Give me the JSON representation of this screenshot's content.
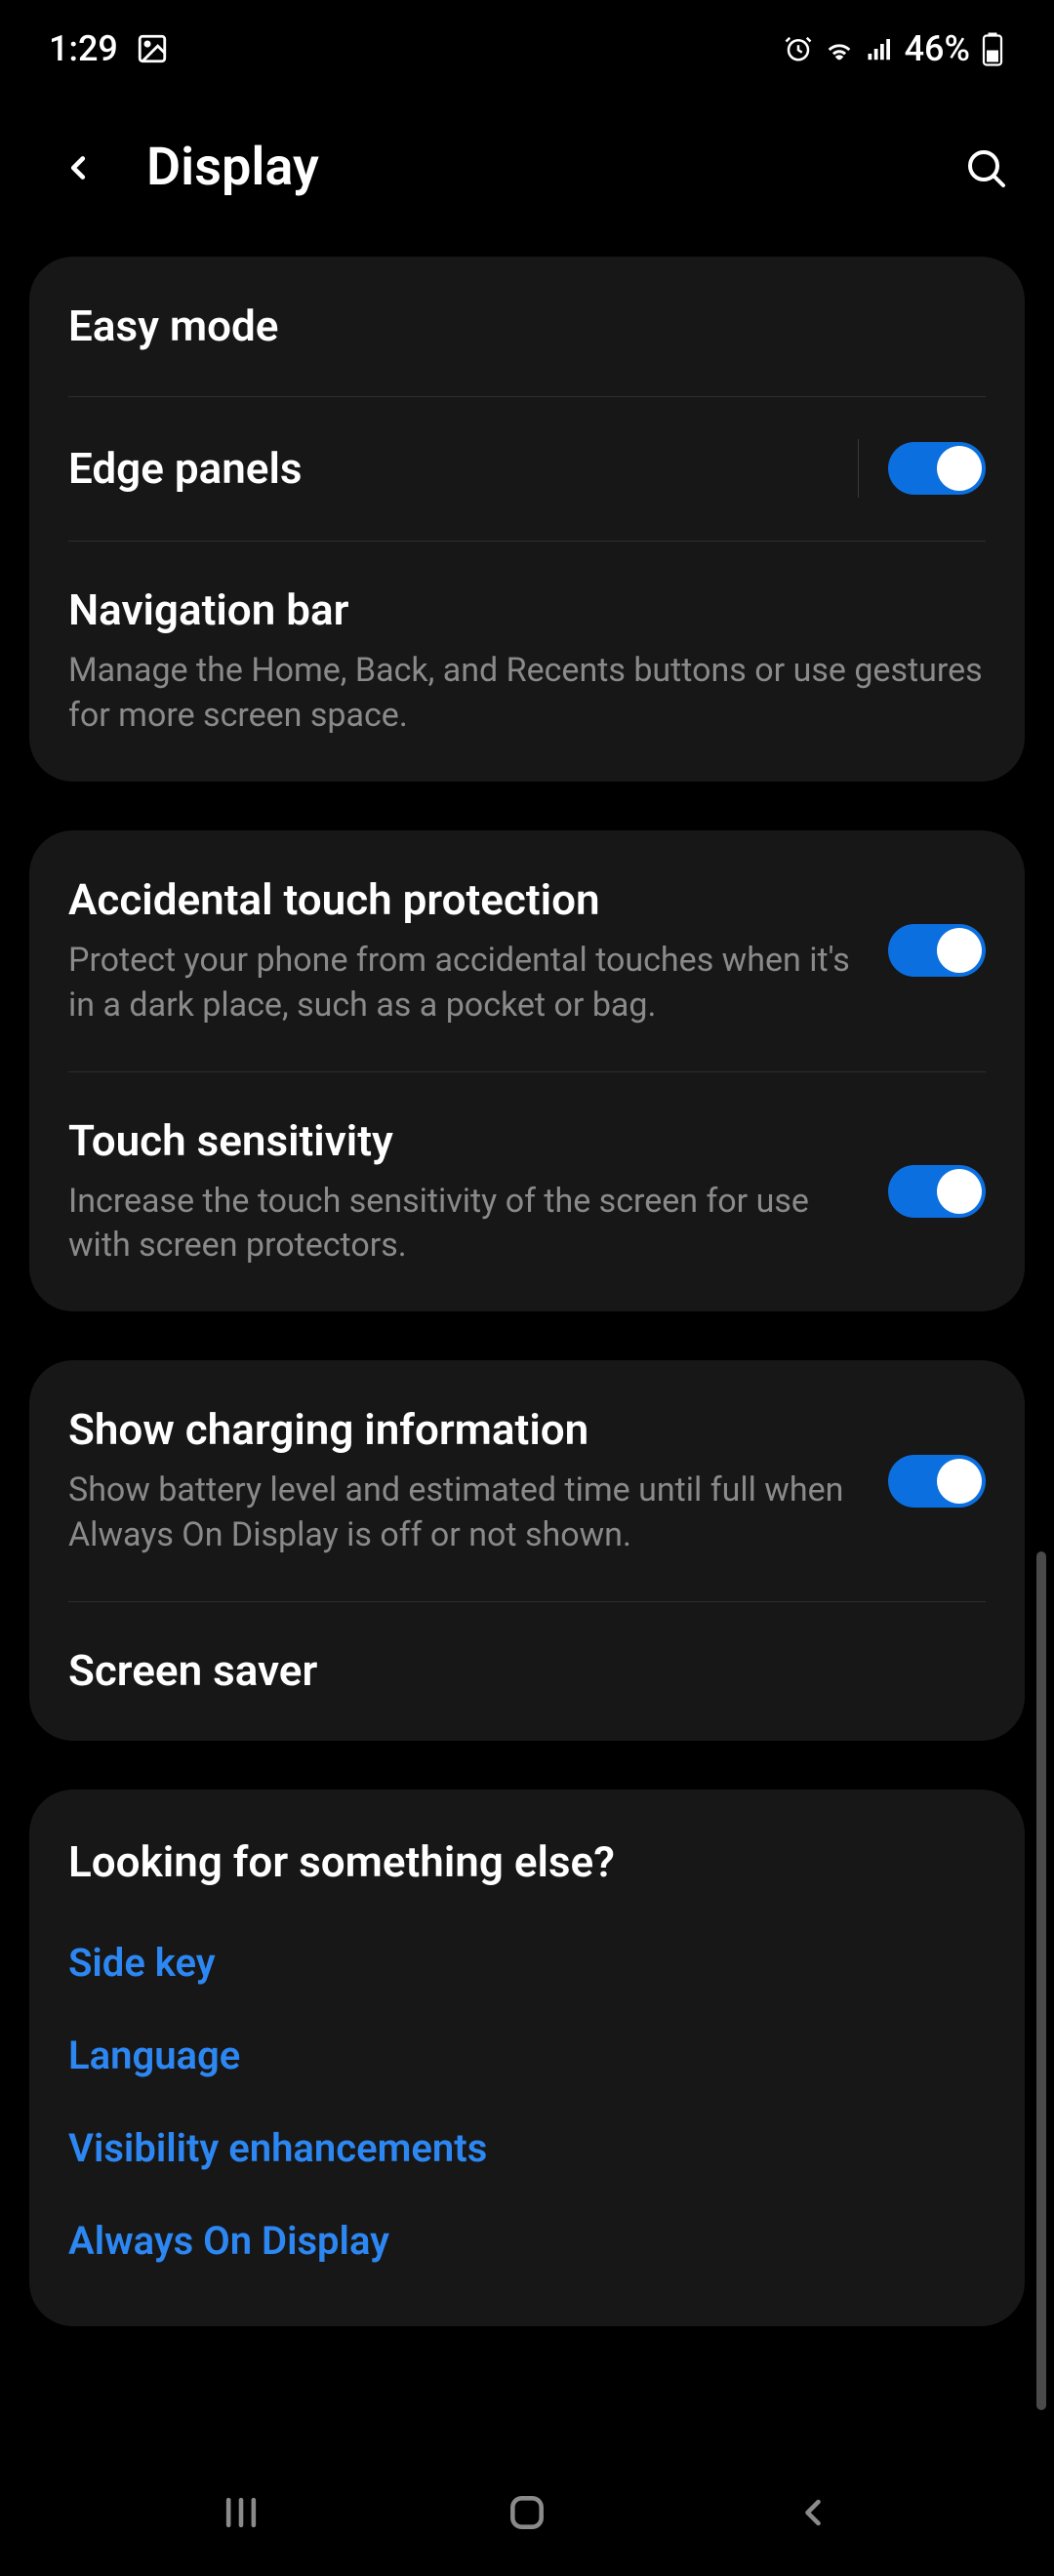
{
  "status": {
    "time": "1:29",
    "battery": "46%"
  },
  "header": {
    "title": "Display"
  },
  "groups": [
    {
      "rows": [
        {
          "title": "Easy mode"
        },
        {
          "title": "Edge panels",
          "toggle": true,
          "divider": true
        },
        {
          "title": "Navigation bar",
          "sub": "Manage the Home, Back, and Recents buttons or use gestures for more screen space."
        }
      ]
    },
    {
      "rows": [
        {
          "title": "Accidental touch protection",
          "sub": "Protect your phone from accidental touches when it's in a dark place, such as a pocket or bag.",
          "toggle": true
        },
        {
          "title": "Touch sensitivity",
          "sub": "Increase the touch sensitivity of the screen for use with screen protectors.",
          "toggle": true
        }
      ]
    },
    {
      "rows": [
        {
          "title": "Show charging information",
          "sub": "Show battery level and estimated time until full when Always On Display is off or not shown.",
          "toggle": true
        },
        {
          "title": "Screen saver"
        }
      ]
    }
  ],
  "looking": {
    "title": "Looking for something else?",
    "links": [
      "Side key",
      "Language",
      "Visibility enhancements",
      "Always On Display"
    ]
  }
}
